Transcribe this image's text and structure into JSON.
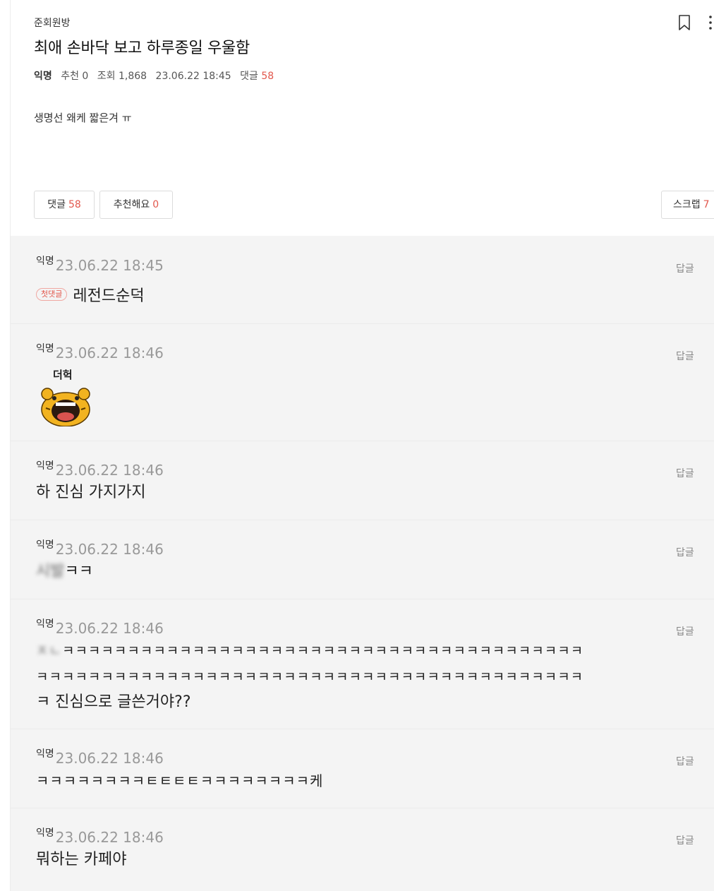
{
  "post": {
    "board": "준회원방",
    "title": "최애 손바닥 보고 하루종일 우울함",
    "author": "익명",
    "likes_label": "추천 0",
    "views_label": "조회 1,868",
    "date": "23.06.22 18:45",
    "comments_label": "댓글",
    "comments_count": "58",
    "body": "생명선 왜케 짧은겨 ㅠ"
  },
  "buttons": {
    "comments_label": "댓글",
    "comments_count": "58",
    "like_label": "추천해요",
    "like_count": "0",
    "scrap_label": "스크랩",
    "scrap_count": "7"
  },
  "icons": {
    "bookmark": "bookmark-icon",
    "more": "more-vertical-icon"
  },
  "reply_label": "답글",
  "comments": [
    {
      "author": "익명",
      "date": "23.06.22 18:45",
      "badge": "첫댓글",
      "text": "레전드순덕"
    },
    {
      "author": "익명",
      "date": "23.06.22 18:46",
      "sticker_text": "더헉"
    },
    {
      "author": "익명",
      "date": "23.06.22 18:46",
      "text": "하 진심 가지가지"
    },
    {
      "author": "익명",
      "date": "23.06.22 18:46",
      "text_blur": "시발",
      "text": "ㅋㅋ"
    },
    {
      "author": "익명",
      "date": "23.06.22 18:46",
      "line1_blur": "ㅈㄴ",
      "line1": "ㅋㅋㅋㅋㅋㅋㅋㅋㅋㅋㅋㅋㅋㅋㅋㅋㅋㅋㅋㅋㅋㅋㅋㅋㅋㅋㅋㅋㅋㅋㅋㅋㅋㅋㅋㅋㅋㅋㅋㅋ",
      "line2": "ㅋㅋㅋㅋㅋㅋㅋㅋㅋㅋㅋㅋㅋㅋㅋㅋㅋㅋㅋㅋㅋㅋㅋㅋㅋㅋㅋㅋㅋㅋㅋㅋㅋㅋㅋㅋㅋㅋㅋㅋㅋㅋ",
      "line3": "ㅋ 진심으로 글쓴거야??"
    },
    {
      "author": "익명",
      "date": "23.06.22 18:46",
      "text": "ㅋㅋㅋㅋㅋㅋㅋㅋㅌㅌㅌㅌㅋㅋㅋㅋㅋㅋㅋㅋ케"
    },
    {
      "author": "익명",
      "date": "23.06.22 18:46",
      "text": "뭐하는 카페야"
    }
  ],
  "colors": {
    "accent_red": "#e2574c",
    "comment_bg": "#f4f4f4",
    "sticker_yellow": "#f2b320"
  }
}
